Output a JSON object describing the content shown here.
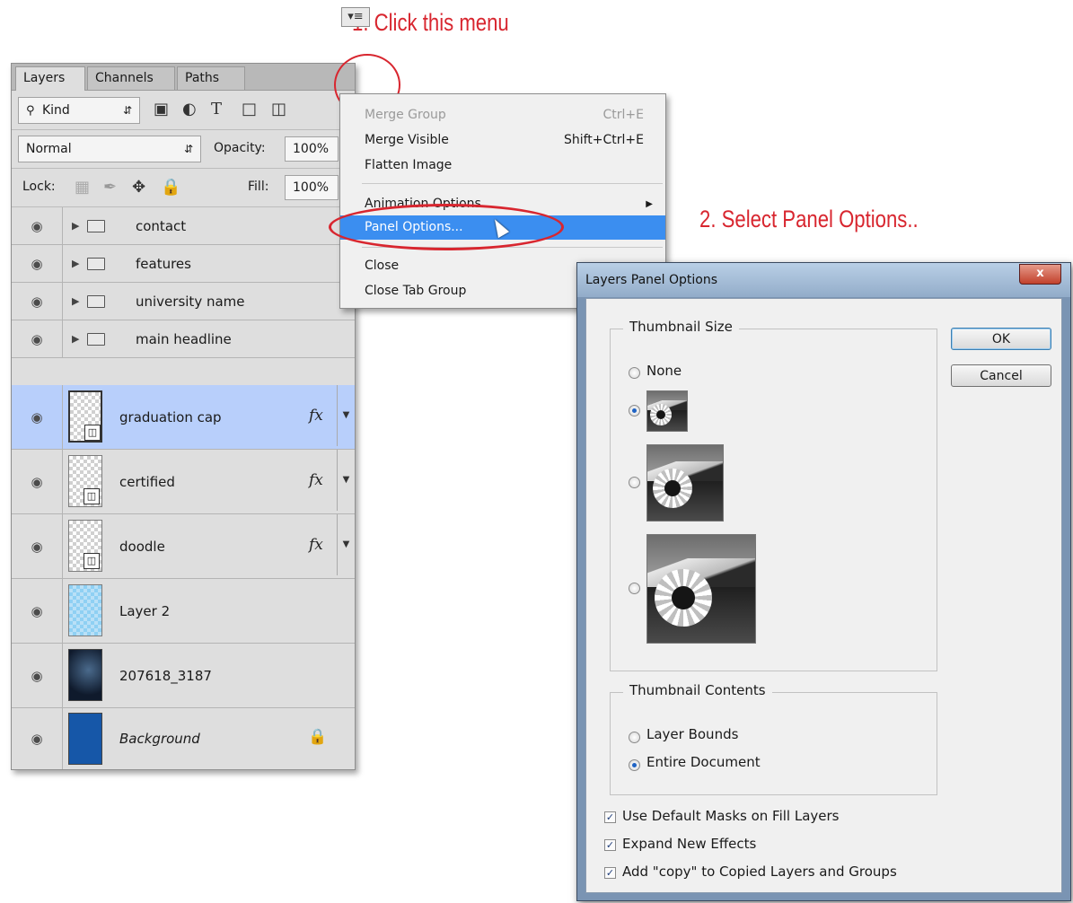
{
  "annotations": {
    "step1": "1. Click this menu",
    "step2": "2. Select Panel Options.."
  },
  "layers_panel": {
    "tabs": [
      {
        "label": "Layers"
      },
      {
        "label": "Channels"
      },
      {
        "label": "Paths"
      }
    ],
    "menu_icon": "panel-menu-icon",
    "filter": {
      "kind_label": "Kind"
    },
    "blend_mode": "Normal",
    "opacity_label": "Opacity:",
    "opacity_value": "100%",
    "lock_label": "Lock:",
    "fill_label": "Fill:",
    "fill_value": "100%",
    "fx_label": "fx",
    "layers": [
      {
        "name": "contact",
        "type": "group"
      },
      {
        "name": "features",
        "type": "group"
      },
      {
        "name": "university name",
        "type": "group"
      },
      {
        "name": "main headline",
        "type": "group"
      },
      {
        "name": "graduation cap",
        "type": "smart-object",
        "fx": true,
        "selected": true
      },
      {
        "name": "certified",
        "type": "smart-object",
        "fx": true
      },
      {
        "name": "doodle",
        "type": "smart-object",
        "fx": true
      },
      {
        "name": "Layer 2",
        "type": "pixel"
      },
      {
        "name": "207618_3187",
        "type": "pixel"
      },
      {
        "name": "Background",
        "type": "background",
        "locked": true
      }
    ]
  },
  "flyout_menu": {
    "items": [
      {
        "label": "Merge Group",
        "shortcut": "Ctrl+E",
        "disabled": true
      },
      {
        "label": "Merge Visible",
        "shortcut": "Shift+Ctrl+E"
      },
      {
        "label": "Flatten Image"
      },
      {
        "label": "Animation Options"
      },
      {
        "label": "Panel Options...",
        "highlighted": true
      },
      {
        "label": "Close"
      },
      {
        "label": "Close Tab Group"
      }
    ]
  },
  "dialog": {
    "title": "Layers Panel Options",
    "close_label": "x",
    "thumbnail_size": {
      "title": "Thumbnail Size",
      "none_label": "None",
      "selected": "small"
    },
    "thumbnail_contents": {
      "title": "Thumbnail Contents",
      "options": [
        {
          "label": "Layer Bounds",
          "checked": false
        },
        {
          "label": "Entire Document",
          "checked": true
        }
      ]
    },
    "checkboxes": [
      {
        "label": "Use Default Masks on Fill Layers",
        "checked": true
      },
      {
        "label": "Expand New Effects",
        "checked": true
      },
      {
        "label": "Add \"copy\" to Copied Layers and Groups",
        "checked": true
      }
    ],
    "ok_label": "OK",
    "cancel_label": "Cancel"
  },
  "colors": {
    "annotation": "#d8262f",
    "selection": "#b8cffb",
    "menu_highlight": "#3b8ef0"
  }
}
